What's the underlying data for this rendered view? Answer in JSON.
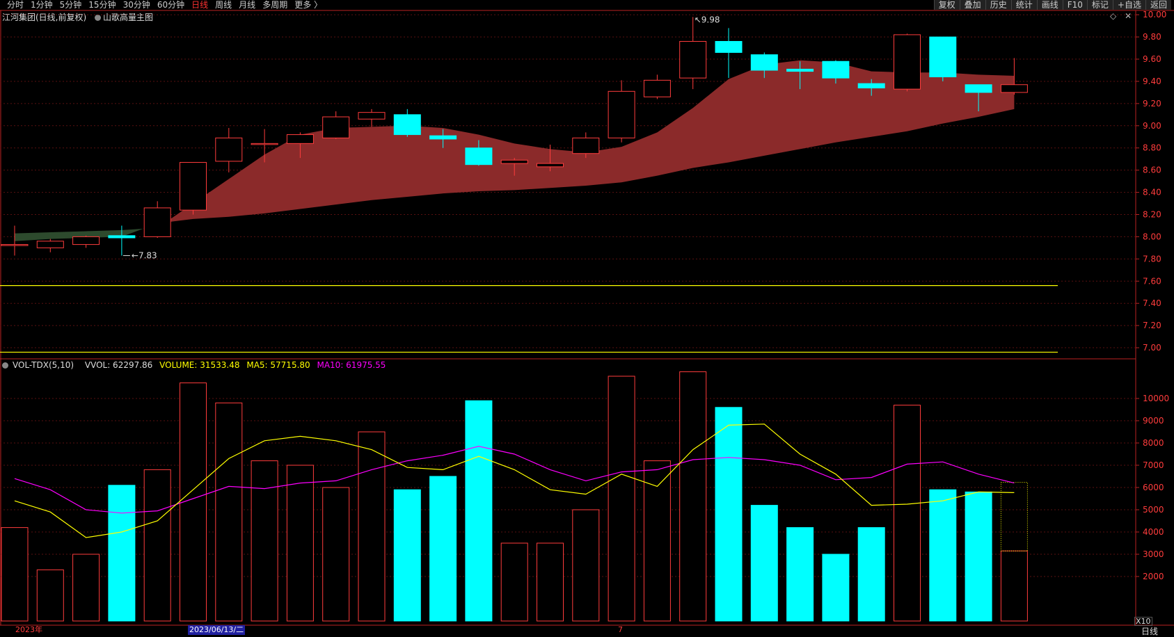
{
  "toolbar": {
    "periods": [
      "分时",
      "1分钟",
      "5分钟",
      "15分钟",
      "30分钟",
      "60分钟",
      "日线",
      "周线",
      "月线",
      "多周期",
      "更多 〉"
    ],
    "active_period": "日线",
    "buttons": [
      "复权",
      "叠加",
      "历史",
      "统计",
      "画线",
      "F10",
      "标记",
      "+自选",
      "返回"
    ]
  },
  "header": {
    "stock_title": "江河集团(日线,前复权)",
    "indicator_name": "山歌高量主图"
  },
  "price_axis": {
    "ticks": [
      "10.00",
      "9.80",
      "9.60",
      "9.40",
      "9.20",
      "9.00",
      "8.80",
      "8.60",
      "8.40",
      "8.20",
      "8.00",
      "7.80",
      "7.60",
      "7.40",
      "7.20",
      "7.00"
    ]
  },
  "annotations": {
    "high": "9.98",
    "low": "7.83"
  },
  "vol_panel": {
    "name": "VOL-TDX(5,10)",
    "vvol": "VVOL: 62297.86",
    "volume": "VOLUME: 31533.48",
    "ma5": "MA5: 57715.80",
    "ma10": "MA10: 61975.55",
    "y_ticks": [
      "10000",
      "9000",
      "8000",
      "7000",
      "6000",
      "5000",
      "4000",
      "3000",
      "2000"
    ],
    "unit": "X10"
  },
  "x_axis": {
    "left": "2023年",
    "cursor": "2023/06/13/二",
    "month": "7"
  },
  "footer_period": "日线",
  "colors": {
    "up": "#ff3c3c",
    "down": "#00ffff",
    "ma5": "#ffff00",
    "ma10": "#ff00ff",
    "ribbon_red": "#8b2a2a",
    "ribbon_green": "#2d4a2d",
    "hline": "#ffff00"
  },
  "chart_data": {
    "type": "candlestick",
    "candles": [
      {
        "o": 7.93,
        "c": 7.93,
        "h": 8.1,
        "l": 7.83,
        "v": 4200
      },
      {
        "o": 7.9,
        "c": 7.96,
        "h": 7.98,
        "l": 7.86,
        "v": 2300
      },
      {
        "o": 7.93,
        "c": 8.0,
        "h": 8.01,
        "l": 7.9,
        "v": 3000
      },
      {
        "o": 8.01,
        "c": 7.99,
        "h": 8.1,
        "l": 7.83,
        "v": 6100
      },
      {
        "o": 8.0,
        "c": 8.26,
        "h": 8.32,
        "l": 7.99,
        "v": 6800
      },
      {
        "o": 8.24,
        "c": 8.67,
        "h": 8.67,
        "l": 8.2,
        "v": 10700
      },
      {
        "o": 8.68,
        "c": 8.89,
        "h": 8.98,
        "l": 8.58,
        "v": 9800
      },
      {
        "o": 8.84,
        "c": 8.84,
        "h": 8.97,
        "l": 8.67,
        "v": 7200
      },
      {
        "o": 8.84,
        "c": 8.92,
        "h": 8.94,
        "l": 8.71,
        "v": 7000
      },
      {
        "o": 8.89,
        "c": 9.08,
        "h": 9.13,
        "l": 8.88,
        "v": 6000
      },
      {
        "o": 9.06,
        "c": 9.12,
        "h": 9.15,
        "l": 8.99,
        "v": 8500
      },
      {
        "o": 9.1,
        "c": 8.92,
        "h": 9.15,
        "l": 8.9,
        "v": 5900
      },
      {
        "o": 8.91,
        "c": 8.88,
        "h": 8.97,
        "l": 8.8,
        "v": 6500
      },
      {
        "o": 8.8,
        "c": 8.65,
        "h": 8.87,
        "l": 8.64,
        "v": 9900
      },
      {
        "o": 8.66,
        "c": 8.69,
        "h": 8.71,
        "l": 8.55,
        "v": 3500
      },
      {
        "o": 8.63,
        "c": 8.66,
        "h": 8.83,
        "l": 8.59,
        "v": 3500
      },
      {
        "o": 8.75,
        "c": 8.89,
        "h": 8.94,
        "l": 8.71,
        "v": 5000
      },
      {
        "o": 8.89,
        "c": 9.31,
        "h": 9.41,
        "l": 8.85,
        "v": 11000
      },
      {
        "o": 9.26,
        "c": 9.41,
        "h": 9.46,
        "l": 9.24,
        "v": 7200
      },
      {
        "o": 9.43,
        "c": 9.76,
        "h": 9.98,
        "l": 9.33,
        "v": 11200
      },
      {
        "o": 9.76,
        "c": 9.66,
        "h": 9.88,
        "l": 9.43,
        "v": 9600
      },
      {
        "o": 9.64,
        "c": 9.5,
        "h": 9.66,
        "l": 9.43,
        "v": 5200
      },
      {
        "o": 9.51,
        "c": 9.49,
        "h": 9.58,
        "l": 9.33,
        "v": 4200
      },
      {
        "o": 9.58,
        "c": 9.43,
        "h": 9.59,
        "l": 9.38,
        "v": 3000
      },
      {
        "o": 9.38,
        "c": 9.34,
        "h": 9.42,
        "l": 9.27,
        "v": 4200
      },
      {
        "o": 9.33,
        "c": 9.82,
        "h": 9.83,
        "l": 9.31,
        "v": 9700
      },
      {
        "o": 9.8,
        "c": 9.44,
        "h": 9.8,
        "l": 9.4,
        "v": 5900
      },
      {
        "o": 9.37,
        "c": 9.3,
        "h": 9.37,
        "l": 9.13,
        "v": 5800
      },
      {
        "o": 9.3,
        "c": 9.37,
        "h": 9.61,
        "l": 9.28,
        "v": 3150
      }
    ],
    "ma5": [
      5400,
      4900,
      3750,
      4000,
      4500,
      5900,
      7300,
      8100,
      8300,
      8100,
      7700,
      6900,
      6800,
      7400,
      6800,
      5900,
      5700,
      6600,
      6050,
      7700,
      8800,
      8850,
      7500,
      6600,
      5200,
      5250,
      5400,
      5800,
      5770
    ],
    "ma10": [
      6400,
      5900,
      5000,
      4850,
      4950,
      5500,
      6050,
      5950,
      6200,
      6300,
      6800,
      7200,
      7450,
      7850,
      7500,
      6800,
      6300,
      6700,
      6800,
      7250,
      7350,
      7250,
      7000,
      6350,
      6450,
      7050,
      7150,
      6600,
      6200
    ],
    "ribbon_upper": [
      8.03,
      8.04,
      8.05,
      8.06,
      8.08,
      8.3,
      8.52,
      8.74,
      8.92,
      8.98,
      8.99,
      9.0,
      8.98,
      8.92,
      8.84,
      8.79,
      8.76,
      8.81,
      8.94,
      9.16,
      9.42,
      9.55,
      9.59,
      9.57,
      9.49,
      9.48,
      9.48,
      9.46,
      9.45
    ],
    "ribbon_lower": [
      7.96,
      7.98,
      7.99,
      8.0,
      8.12,
      8.16,
      8.18,
      8.21,
      8.25,
      8.29,
      8.33,
      8.36,
      8.39,
      8.41,
      8.42,
      8.44,
      8.46,
      8.49,
      8.55,
      8.62,
      8.67,
      8.73,
      8.79,
      8.85,
      8.9,
      8.95,
      9.02,
      9.08,
      9.15
    ],
    "ribbon_split": 4,
    "hlines": [
      7.56,
      6.96
    ],
    "price_range": [
      6.9,
      10.02
    ],
    "volume_range": [
      0,
      11500
    ]
  }
}
